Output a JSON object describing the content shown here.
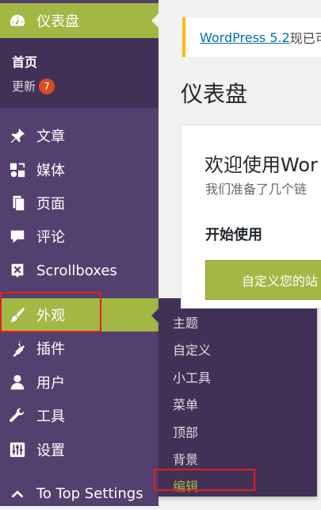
{
  "sidebar": {
    "dashboard": {
      "label": "仪表盘",
      "icon": "dashboard-icon"
    },
    "dashboard_sub": {
      "home": "首页",
      "update": "更新",
      "update_count": "7"
    },
    "items": [
      {
        "label": "文章",
        "icon": "pin-icon"
      },
      {
        "label": "媒体",
        "icon": "media-icon"
      },
      {
        "label": "页面",
        "icon": "pages-icon"
      },
      {
        "label": "评论",
        "icon": "comment-icon"
      },
      {
        "label": "Scrollboxes",
        "icon": "scrollboxes-icon"
      },
      {
        "label": "外观",
        "icon": "appearance-icon"
      },
      {
        "label": "插件",
        "icon": "plugin-icon"
      },
      {
        "label": "用户",
        "icon": "user-icon"
      },
      {
        "label": "工具",
        "icon": "wrench-icon"
      },
      {
        "label": "设置",
        "icon": "settings-icon"
      },
      {
        "label": "To Top Settings",
        "icon": "chevron-up-icon"
      }
    ]
  },
  "flyout": {
    "items": [
      "主题",
      "自定义",
      "小工具",
      "菜单",
      "顶部",
      "背景",
      "编辑"
    ]
  },
  "main": {
    "notice_link": "WordPress 5.2",
    "notice_text": "现已可",
    "page_title": "仪表盘",
    "welcome_title": "欢迎使用Wor",
    "welcome_sub": "我们准备了几个链",
    "get_started": "开始使用",
    "customize_button": "自定义您的站"
  },
  "colors": {
    "sidebar": "#54406e",
    "submenu": "#423157",
    "accent": "#a3b745",
    "highlight_box": "#e02020",
    "badge": "#d54e21"
  }
}
